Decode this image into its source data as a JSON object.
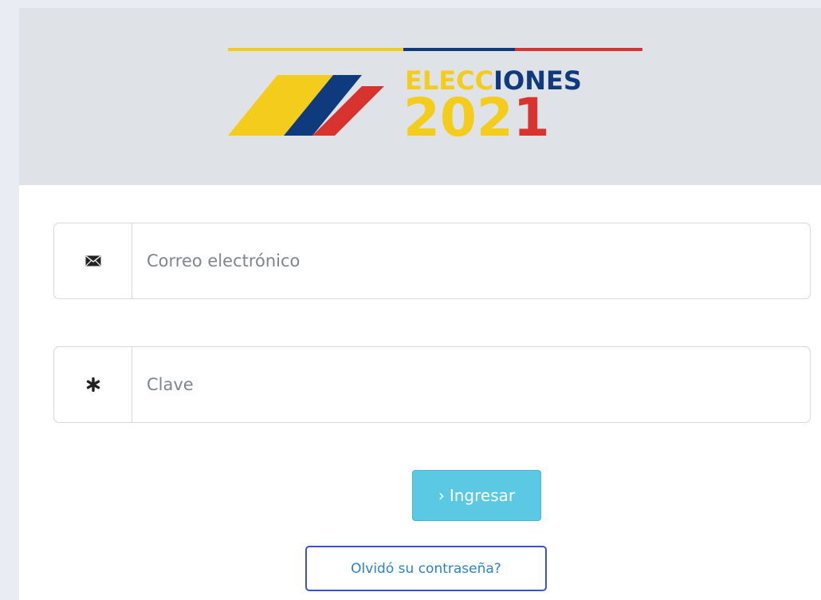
{
  "logo": {
    "word_part1": "ELECC",
    "word_part2": "IONES",
    "year_part1": "202",
    "year_part2": "1"
  },
  "form": {
    "email_placeholder": "Correo electrónico",
    "email_value": "",
    "password_placeholder": "Clave",
    "password_value": "",
    "email_icon": "envelope-icon",
    "password_icon": "asterisk-icon"
  },
  "actions": {
    "login_chevron": "›",
    "login_label": "Ingresar",
    "forgot_label": "Olvidó su contraseña?"
  },
  "colors": {
    "yellow": "#f4cd1c",
    "blue": "#0f3a7e",
    "red": "#d8332f",
    "button": "#5bc8e4",
    "link": "#2b83c4",
    "focus_outline": "#3d50d6"
  }
}
